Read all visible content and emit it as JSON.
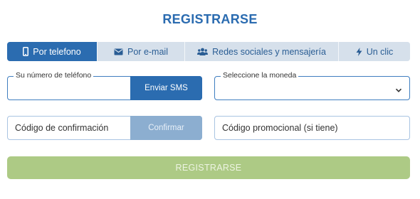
{
  "title": "REGISTRARSE",
  "tabs": [
    {
      "label": "Por telefono",
      "icon": "phone-icon",
      "active": true
    },
    {
      "label": "Por e-mail",
      "icon": "envelope-icon",
      "active": false
    },
    {
      "label": "Redes sociales y mensajería",
      "icon": "users-icon",
      "active": false
    },
    {
      "label": "Un clic",
      "icon": "lightning-icon",
      "active": false
    }
  ],
  "phone": {
    "legend": "Su número de teléfono",
    "value": "",
    "button_label": "Enviar SMS"
  },
  "currency": {
    "legend": "Seleccione la moneda",
    "value": ""
  },
  "confirmation": {
    "placeholder": "Código de confirmación",
    "button_label": "Confirmar"
  },
  "promo": {
    "placeholder": "Código promocional (si tiene)"
  },
  "register_button": {
    "label": "REGISTRARSE"
  },
  "colors": {
    "primary": "#2b6cb0",
    "tab_inactive": "#d6e0eb",
    "register": "#adca85"
  }
}
